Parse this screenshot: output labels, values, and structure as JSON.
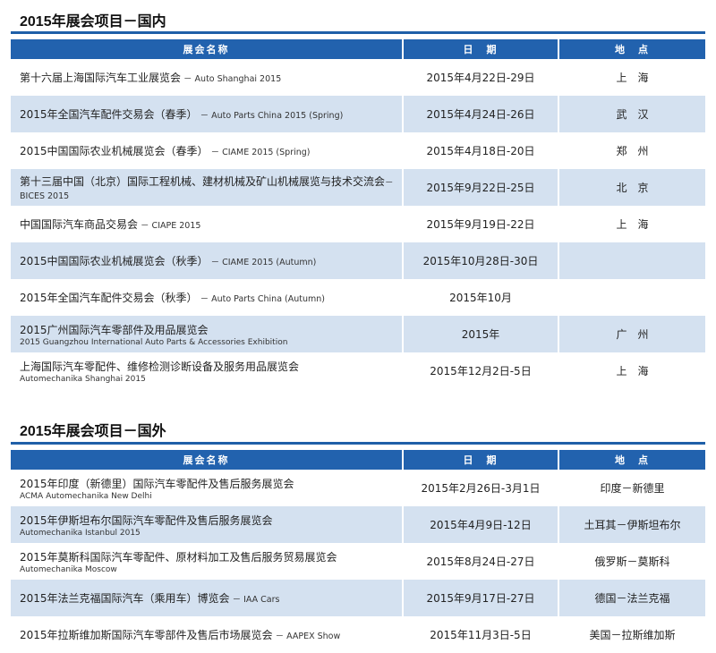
{
  "domestic": {
    "title": "2015年展会项目－国内",
    "headers": [
      "展会名称",
      "日　期",
      "地　点"
    ],
    "rows": [
      {
        "name": "第十六届上海国际汽车工业展览会",
        "en": " － Auto Shanghai 2015",
        "en_inline": true,
        "date": "2015年4月22日-29日",
        "place": "上　海"
      },
      {
        "name": "2015年全国汽车配件交易会（春季）",
        "en": " － Auto Parts China 2015 (Spring)",
        "en_inline": true,
        "date": "2015年4月24日-26日",
        "place": "武　汉"
      },
      {
        "name": "2015中国国际农业机械展览会（春季）",
        "en": " － CIAME 2015 (Spring)",
        "en_inline": true,
        "date": "2015年4月18日-20日",
        "place": "郑　州"
      },
      {
        "name": "第十三届中国（北京）国际工程机械、建材机械及矿山机械展览与技术交流会",
        "en": "－BICES 2015",
        "en_inline": true,
        "date": "2015年9月22日-25日",
        "place": "北　京"
      },
      {
        "name": "中国国际汽车商品交易会",
        "en": " － CIAPE 2015",
        "en_inline": true,
        "date": "2015年9月19日-22日",
        "place": "上　海"
      },
      {
        "name": "2015中国国际农业机械展览会（秋季）",
        "en": " － CIAME 2015 (Autumn)",
        "en_inline": true,
        "date": "2015年10月28日-30日",
        "place": ""
      },
      {
        "name": "2015年全国汽车配件交易会（秋季）",
        "en": " － Auto Parts China (Autumn)",
        "en_inline": true,
        "date": "2015年10月",
        "place": ""
      },
      {
        "name": "2015广州国际汽车零部件及用品展览会",
        "en": "2015 Guangzhou International Auto Parts & Accessories Exhibition",
        "en_inline": false,
        "date": "2015年",
        "place": "广　州"
      },
      {
        "name": "上海国际汽车零配件、维修检测诊断设备及服务用品展览会",
        "en": "Automechanika Shanghai 2015",
        "en_inline": false,
        "date": "2015年12月2日-5日",
        "place": "上　海"
      }
    ]
  },
  "international": {
    "title": "2015年展会项目－国外",
    "headers": [
      "展会名称",
      "日　期",
      "地　点"
    ],
    "rows": [
      {
        "name": "2015年印度（新德里）国际汽车零配件及售后服务展览会",
        "en": "ACMA Automechanika New Delhi",
        "en_inline": false,
        "date": "2015年2月26日-3月1日",
        "place": "印度－新德里"
      },
      {
        "name": "2015年伊斯坦布尔国际汽车零配件及售后服务展览会",
        "en": "Automechanika Istanbul 2015",
        "en_inline": false,
        "date": "2015年4月9日-12日",
        "place": "土耳其－伊斯坦布尔"
      },
      {
        "name": "2015年莫斯科国际汽车零配件、原材料加工及售后服务贸易展览会",
        "en": "Automechanika Moscow",
        "en_inline": false,
        "date": "2015年8月24日-27日",
        "place": "俄罗斯－莫斯科"
      },
      {
        "name": "2015年法兰克福国际汽车（乘用车）博览会",
        "en": " － IAA Cars",
        "en_inline": true,
        "date": "2015年9月17日-27日",
        "place": "德国－法兰克福"
      },
      {
        "name": "2015年拉斯维加斯国际汽车零部件及售后市场展览会",
        "en": " － AAPEX Show",
        "en_inline": true,
        "date": "2015年11月3日-5日",
        "place": "美国－拉斯维加斯"
      }
    ]
  },
  "colors": {
    "header": "#2262ae",
    "alt_row": "#d4e1f0",
    "rule": "#1f5fa8"
  }
}
